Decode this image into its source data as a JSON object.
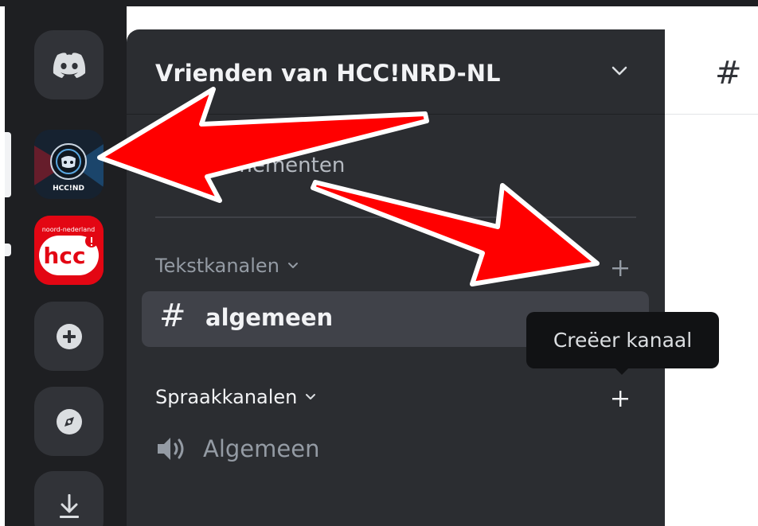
{
  "server_rail": {
    "servers": [
      {
        "name": "discord-home",
        "icon": "discord-logo-icon"
      },
      {
        "name": "HCC!NRD",
        "icon_text": "HCC!ND",
        "active": true
      },
      {
        "name": "hcc",
        "icon_text": "hcc",
        "banner_text": "noord-nederland"
      },
      {
        "name": "add-server",
        "icon": "plus-circle-icon"
      },
      {
        "name": "explore",
        "icon": "compass-icon"
      },
      {
        "name": "download",
        "icon": "download-icon"
      }
    ]
  },
  "sidebar": {
    "server_name": "Vrienden van HCC!NRD-NL",
    "events_label": "venementen",
    "text_category": "Tekstkanalen",
    "text_channels": [
      {
        "name": "algemeen"
      }
    ],
    "voice_category": "Spraakkanalen",
    "voice_channels": [
      {
        "name": "Algemeen"
      }
    ]
  },
  "tooltip": {
    "text": "Creëer kanaal"
  },
  "main": {
    "channel_prefix": "#"
  },
  "colors": {
    "rail_bg": "#1e1f22",
    "sidebar_bg": "#2b2d31",
    "selected_channel_bg": "#404249",
    "annotation_arrow": "#ff0000"
  }
}
